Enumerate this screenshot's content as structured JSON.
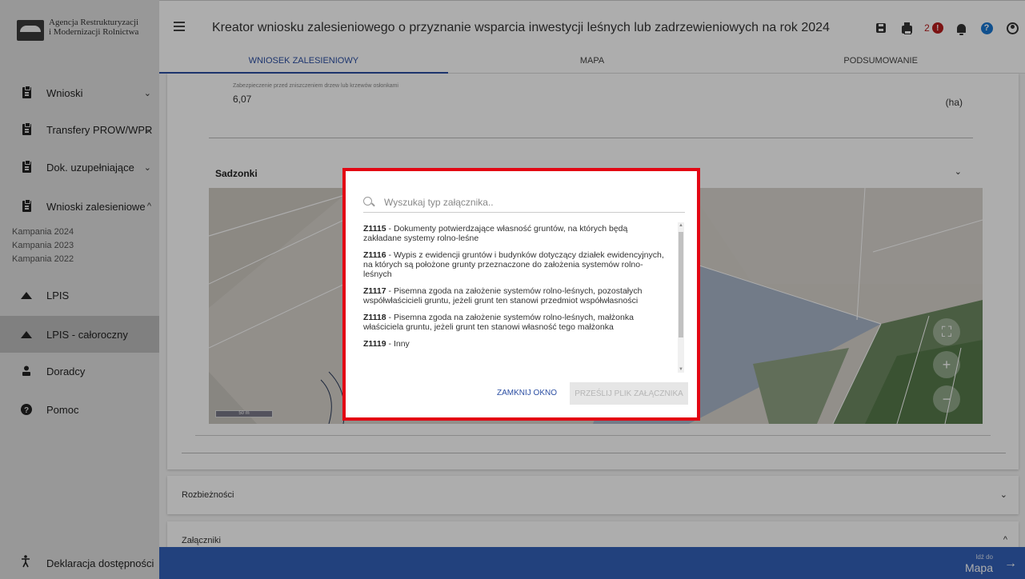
{
  "brand": {
    "line1": "Agencja Restrukturyzacji",
    "line2": "i Modernizacji Rolnictwa"
  },
  "sidebar": {
    "items": [
      {
        "label": "Wnioski",
        "chevron": "⌄"
      },
      {
        "label": "Transfery PROW/WPR",
        "chevron": "⌄"
      },
      {
        "label": "Dok. uzupełniające",
        "chevron": "⌄"
      },
      {
        "label": "Wnioski zalesieniowe",
        "chevron": "^"
      },
      {
        "label": "LPIS"
      },
      {
        "label": "LPIS - całoroczny"
      },
      {
        "label": "Doradcy"
      },
      {
        "label": "Pomoc"
      }
    ],
    "sub_items": [
      "Kampania 2024",
      "Kampania 2023",
      "Kampania 2022"
    ],
    "declaration": "Deklaracja dostępności"
  },
  "header": {
    "title": "Kreator wniosku zalesieniowego o przyznanie wsparcia inwestycji leśnych lub zadrzewieniowych na rok 2024",
    "error_count": "2",
    "error_symbol": "!",
    "help_symbol": "?"
  },
  "tabs": [
    "WNIOSEK ZALESIENIOWY",
    "MAPA",
    "PODSUMOWANIE"
  ],
  "form": {
    "field_label": "Zabezpieczenie przed zniszczeniem drzew lub krzewów osłonkami",
    "field_value": "6,07",
    "field_unit": "(ha)",
    "section_title": "Sadzonki",
    "map_scale": "50 m"
  },
  "accordions": [
    {
      "title": "Rozbieżności",
      "chevron": "⌄"
    },
    {
      "title": "Załączniki",
      "chevron": "^"
    }
  ],
  "bottom_bar": {
    "small": "Idź do",
    "big": "Mapa",
    "arrow": "→"
  },
  "dialog": {
    "search_placeholder": "Wyszukaj typ załącznika..",
    "items": [
      {
        "code": "Z1115",
        "text": " - Dokumenty potwierdzające własność gruntów, na których będą zakładane systemy rolno-leśne"
      },
      {
        "code": "Z1116",
        "text": " - Wypis z ewidencji gruntów i budynków dotyczący działek ewidencyjnych, na których są położone grunty przeznaczone do założenia systemów rolno-leśnych"
      },
      {
        "code": "Z1117",
        "text": " - Pisemna zgoda na założenie systemów rolno-leśnych, pozostałych współwłaścicieli gruntu, jeżeli grunt ten stanowi przedmiot współwłasności"
      },
      {
        "code": "Z1118",
        "text": " - Pisemna zgoda na założenie systemów rolno-leśnych, małżonka właściciela gruntu, jeżeli grunt ten stanowi własność tego małżonka"
      },
      {
        "code": "Z1119",
        "text": " - Inny"
      }
    ],
    "close_label": "ZAMKNIJ OKNO",
    "send_label": "PRZEŚLIJ PLIK ZAŁĄCZNIKA"
  },
  "colors": {
    "accent": "#2c4fa3",
    "bottom_bar": "#3360b8",
    "highlight_frame": "#e30613",
    "error": "#b71c1c"
  },
  "icons": [
    "clipboard-icon",
    "mountain-icon",
    "person-icon",
    "help-circle-icon",
    "accessibility-icon",
    "save-icon",
    "print-icon",
    "bell-icon",
    "account-icon",
    "search-icon"
  ]
}
